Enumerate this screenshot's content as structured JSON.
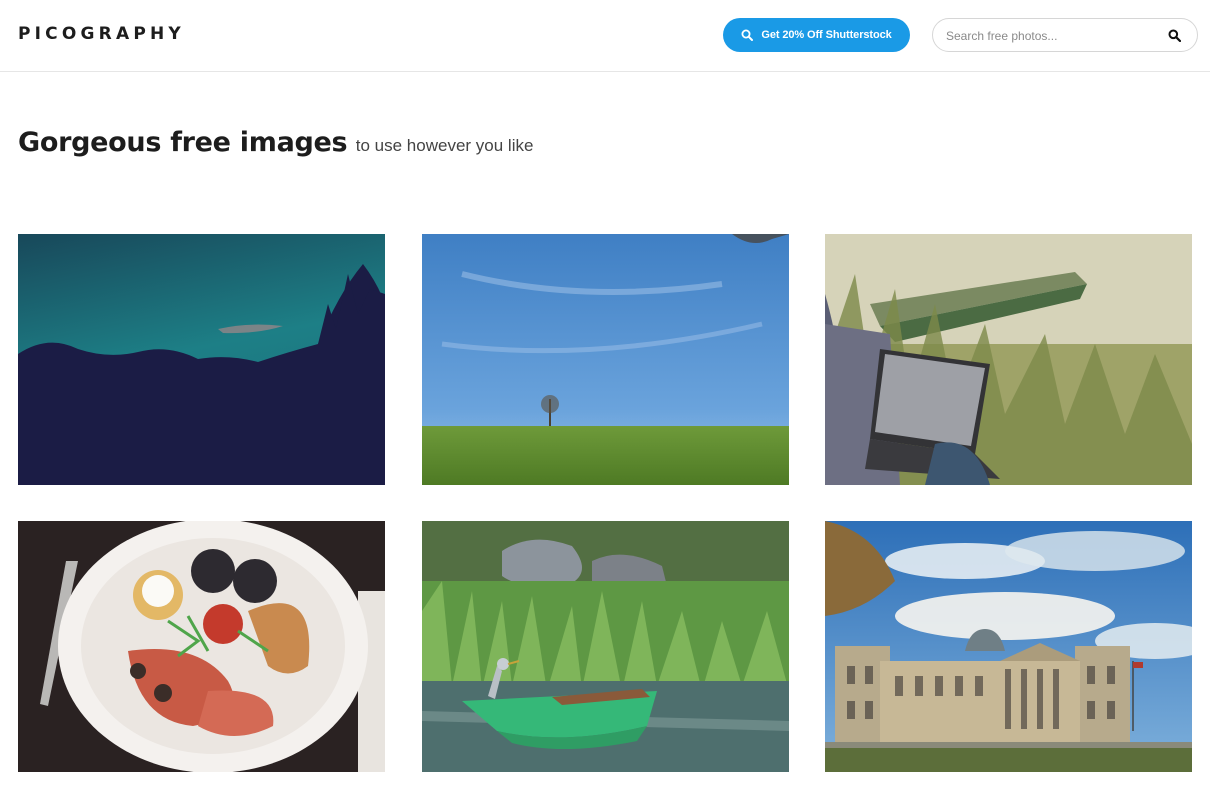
{
  "header": {
    "logo_text": "PICOGRAPHY",
    "cta_label": "Get 20% Off Shutterstock",
    "search_placeholder": "Search free photos..."
  },
  "hero": {
    "title": "Gorgeous free images",
    "subtitle": "to use however you like"
  },
  "photos": [
    {
      "scene": "dusk-silhouette",
      "accent": "#1e6f7a"
    },
    {
      "scene": "lone-tree-field",
      "accent": "#4a86c8"
    },
    {
      "scene": "laptop-rowboat-grass",
      "accent": "#8c9a5a"
    },
    {
      "scene": "breakfast-plate",
      "accent": "#c75a3a"
    },
    {
      "scene": "heron-green-boat",
      "accent": "#3fae78"
    },
    {
      "scene": "reichstag-building",
      "accent": "#3f7fc2"
    }
  ],
  "colors": {
    "cta_background": "#1a9ae6",
    "text_primary": "#1d1d1d",
    "header_border": "#e6e6e6"
  }
}
